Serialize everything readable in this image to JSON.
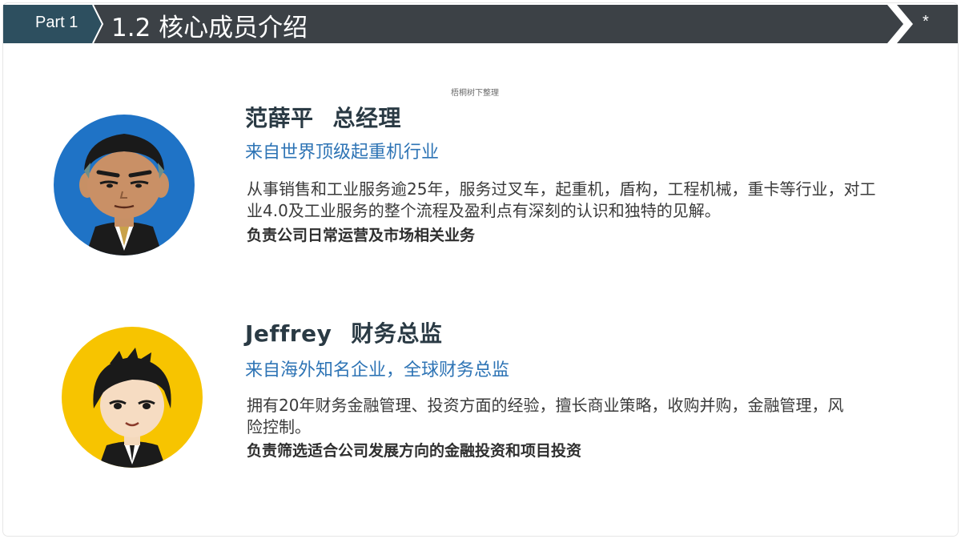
{
  "header": {
    "part_label": "Part 1",
    "title": "1.2 核心成员介绍",
    "corner_mark": "*",
    "band_color": "#3c4146",
    "accent_color": "#2d4f5f"
  },
  "watermark": "梧桐树下整理",
  "members": [
    {
      "name": "范薛平",
      "role": "总经理",
      "origin": "来自世界顶级起重机行业",
      "description": "从事销售和工业服务逾25年，服务过叉车，起重机，盾构，工程机械，重卡等行业，对工业4.0及工业服务的整个流程及盈利点有深刻的认识和独特的见解。",
      "duty": "负责公司日常运营及市场相关业务",
      "avatar_bg": "#1f73c6"
    },
    {
      "name": "Jeffrey",
      "role": "财务总监",
      "origin": "来自海外知名企业，全球财务总监",
      "description": "拥有20年财务金融管理、投资方面的经验，擅长商业策略，收购并购，金融管理，风险控制。",
      "duty": "负责筛选适合公司发展方向的金融投资和项目投资",
      "avatar_bg": "#f7c400"
    }
  ]
}
